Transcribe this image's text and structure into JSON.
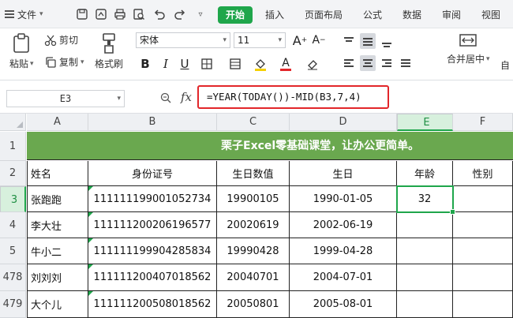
{
  "menubar": {
    "file_label": "文件",
    "tabs": [
      "开始",
      "插入",
      "页面布局",
      "公式",
      "数据",
      "审阅",
      "视图"
    ],
    "active_tab": "开始",
    "quick_icons": [
      "save-icon",
      "export-icon",
      "print-icon",
      "print-preview-icon",
      "undo-icon",
      "redo-icon",
      "more-icon"
    ]
  },
  "ribbon": {
    "paste_label": "粘贴",
    "cut_label": "剪切",
    "copy_label": "复制",
    "format_painter_label": "格式刷",
    "font_name": "宋体",
    "font_size": "11",
    "merge_label": "合并居中",
    "wrap_label": "自"
  },
  "formula_bar": {
    "cell_ref": "E3",
    "fx_label": "fx",
    "formula": "=YEAR(TODAY())-MID(B3,7,4)"
  },
  "sheet": {
    "columns": [
      "A",
      "B",
      "C",
      "D",
      "E",
      "F"
    ],
    "row_numbers": [
      "1",
      "2",
      "3",
      "4",
      "5",
      "478",
      "479"
    ],
    "banner_text": "栗子Excel零基础课堂，让办公更简单。",
    "headers": [
      "姓名",
      "身份证号",
      "生日数值",
      "生日",
      "年龄",
      "性别"
    ],
    "rows": [
      [
        "张跑跑",
        "111111199001052734",
        "19900105",
        "1990-01-05",
        "32",
        ""
      ],
      [
        "李大壮",
        "111111200206196577",
        "20020619",
        "2002-06-19",
        "",
        ""
      ],
      [
        "牛小二",
        "111111199904285834",
        "19990428",
        "1999-04-28",
        "",
        ""
      ],
      [
        "刘刘刘",
        "111111200407018562",
        "20040701",
        "2004-07-01",
        "",
        ""
      ],
      [
        "大个儿",
        "111111200508018562",
        "20050801",
        "2005-08-01",
        "",
        ""
      ]
    ],
    "selected_cell": "E3",
    "colors": {
      "accent": "#1fa64b",
      "banner": "#6aa84f",
      "formula_highlight": "#e2262a"
    }
  }
}
